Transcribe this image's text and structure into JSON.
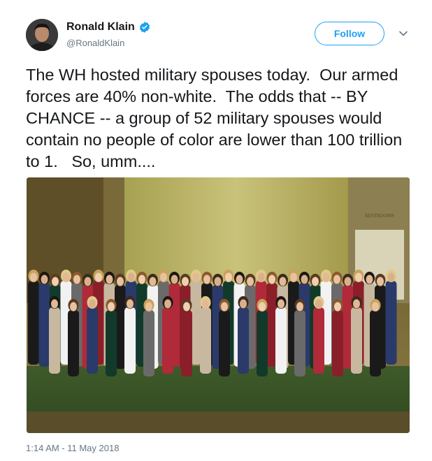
{
  "author": {
    "name": "Ronald Klain",
    "handle": "@RonaldKlain",
    "verified": true
  },
  "follow_button": {
    "label": "Follow"
  },
  "more_menu_icon": "chevron-down-icon",
  "tweet": {
    "text": "The WH hosted military spouses today.  Our armed forces are 40% non-white.  The odds that -- BY CHANCE -- a group of 52 military spouses would contain no people of color are lower than 100 trillion to 1.   So, umm....",
    "photo_sign": "RESTROOMS",
    "timestamp": "1:14 AM - 11 May 2018"
  },
  "colors": {
    "accent": "#1da1f2",
    "text": "#14171a",
    "secondary_text": "#657786"
  }
}
